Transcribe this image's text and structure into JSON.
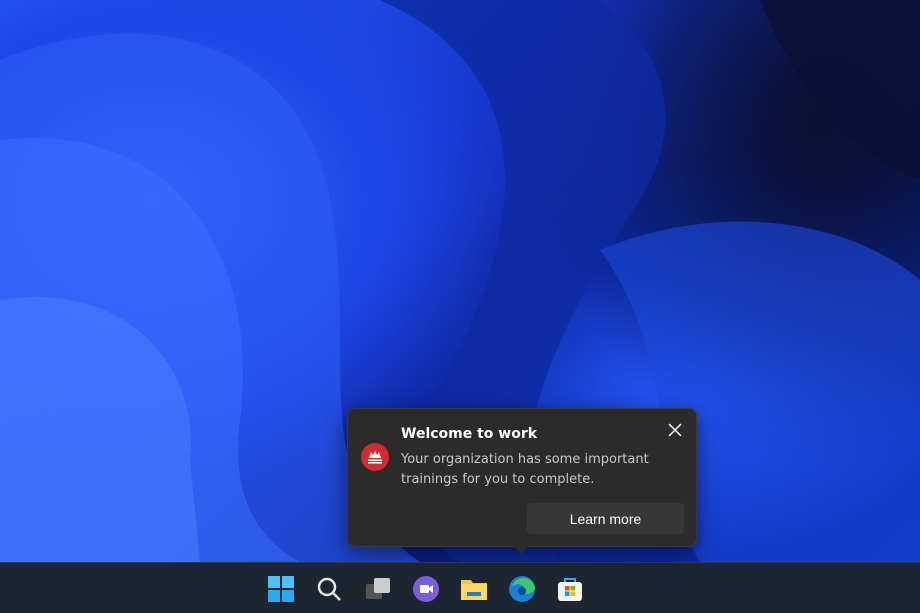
{
  "notification": {
    "title": "Welcome to work",
    "body": "Your organization has some important trainings for you to complete.",
    "action_label": "Learn more",
    "app_icon_color": "#d42a30"
  },
  "taskbar": {
    "items": [
      {
        "name": "start",
        "icon": "windows-logo-icon"
      },
      {
        "name": "search",
        "icon": "search-icon"
      },
      {
        "name": "task-view",
        "icon": "task-view-icon"
      },
      {
        "name": "teams-chat",
        "icon": "teams-chat-icon"
      },
      {
        "name": "file-explorer",
        "icon": "folder-icon"
      },
      {
        "name": "edge",
        "icon": "edge-icon"
      },
      {
        "name": "microsoft-store",
        "icon": "store-icon"
      }
    ]
  }
}
